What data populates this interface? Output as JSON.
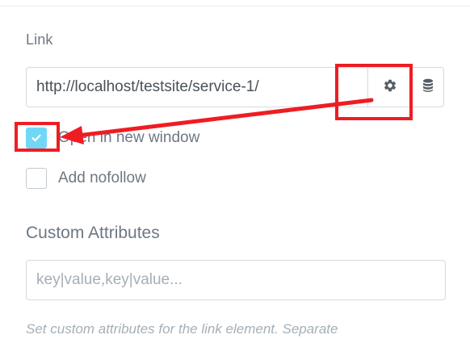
{
  "link": {
    "label": "Link",
    "url_value": "http://localhost/testsite/service-1/",
    "options_icon": "gear-icon",
    "dynamic_icon": "database-icon"
  },
  "options": {
    "new_window": {
      "label": "Open in new window",
      "checked": true
    },
    "nofollow": {
      "label": "Add nofollow",
      "checked": false
    }
  },
  "custom_attributes": {
    "label": "Custom Attributes",
    "placeholder": "key|value,key|value...",
    "value": "",
    "description": "Set custom attributes for the link element. Separate"
  },
  "colors": {
    "annotation_red": "#ee1d23",
    "checkbox_checked": "#71d7f7",
    "label_text": "#6d7882"
  }
}
